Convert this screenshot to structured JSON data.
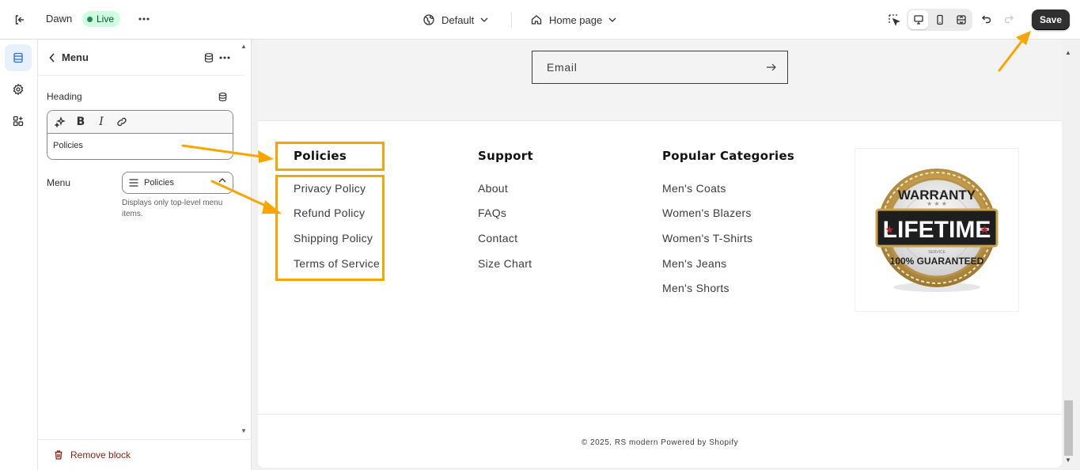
{
  "topbar": {
    "theme_name": "Dawn",
    "live_badge": "Live",
    "preset_label": "Default",
    "page_label": "Home page",
    "save_label": "Save"
  },
  "panel": {
    "title": "Menu",
    "heading_label": "Heading",
    "heading_value": "Policies",
    "menu_label": "Menu",
    "menu_value": "Policies",
    "menu_help": "Displays only top-level menu items.",
    "remove_label": "Remove block"
  },
  "preview": {
    "email_placeholder": "Email",
    "columns": [
      {
        "heading": "Policies",
        "links": [
          "Privacy Policy",
          "Refund Policy",
          "Shipping Policy",
          "Terms of Service"
        ]
      },
      {
        "heading": "Support",
        "links": [
          "About",
          "FAQs",
          "Contact",
          "Size Chart"
        ]
      },
      {
        "heading": "Popular Categories",
        "links": [
          "Men's Coats",
          "Women's Blazers",
          "Women's T-Shirts",
          "Men's Jeans",
          "Men's Shorts"
        ]
      }
    ],
    "badge": {
      "top_text": "WARRANTY",
      "main_text": "LIFETIME",
      "bottom_text": "100% GUARANTEED",
      "small_text": "SERVICE"
    },
    "copyright": "© 2025, RS modern Powered by Shopify"
  },
  "colors": {
    "accent_annotation": "#f7a600",
    "save_button": "#303030",
    "live_badge_bg": "#cdfee1",
    "danger": "#8e1f0b"
  },
  "icons": [
    "exit-icon",
    "more-icon",
    "globe-icon",
    "home-icon",
    "chevron-down-icon",
    "inspector-icon",
    "desktop-icon",
    "mobile-icon",
    "fullwidth-icon",
    "undo-icon",
    "redo-icon",
    "sections-icon",
    "settings-icon",
    "apps-icon",
    "back-icon",
    "database-icon",
    "sparkle-icon",
    "bold-icon",
    "italic-icon",
    "link-icon",
    "menu-list-icon",
    "chevron-up-icon",
    "trash-icon",
    "arrow-right-icon"
  ]
}
